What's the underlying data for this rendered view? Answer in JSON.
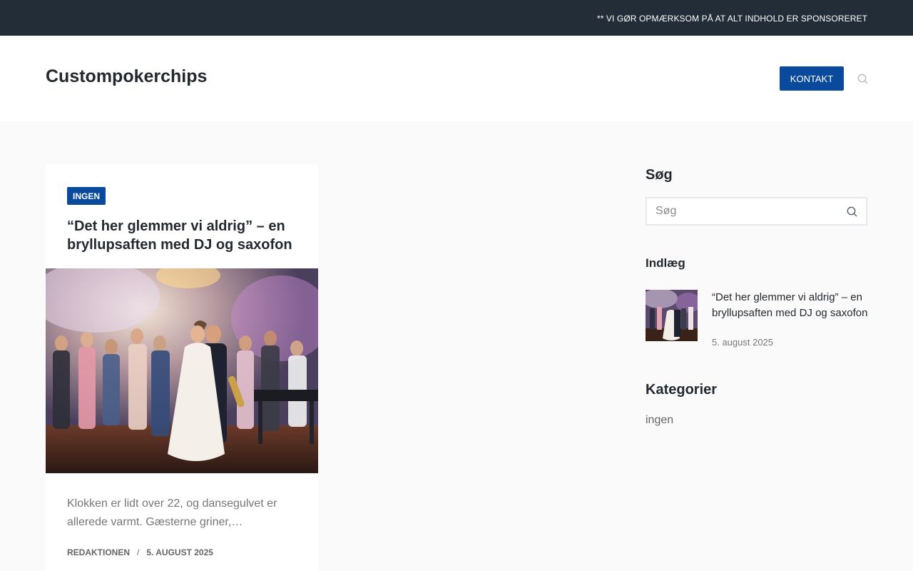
{
  "topbar": {
    "notice": "** VI GØR OPMÆRKSOM PÅ AT ALT INDHOLD ER SPONSORERET"
  },
  "header": {
    "site_title": "Custompokerchips",
    "contact_label": "KONTAKT",
    "search_icon": "search-icon"
  },
  "article": {
    "category": "INGEN",
    "title": "“Det her glemmer vi aldrig” – en bryllupsaften med DJ og saxofon",
    "excerpt": "Klokken er lidt over 22, og dansegulvet er allerede varmt. Gæsterne griner,…",
    "author": "REDAKTIONEN",
    "separator": "/",
    "date": "5. AUGUST 2025"
  },
  "sidebar": {
    "search_heading": "Søg",
    "search_placeholder": "Søg",
    "posts_heading": "Indlæg",
    "recent_post": {
      "title": "“Det her glemmer vi aldrig” – en bryllupsaften med DJ og saxofon",
      "date": "5. august 2025"
    },
    "categories_heading": "Kategorier",
    "categories": [
      "ingen"
    ]
  },
  "colors": {
    "accent": "#0a4a9c",
    "topbar_bg": "#232d38",
    "page_bg": "#fafafa"
  }
}
